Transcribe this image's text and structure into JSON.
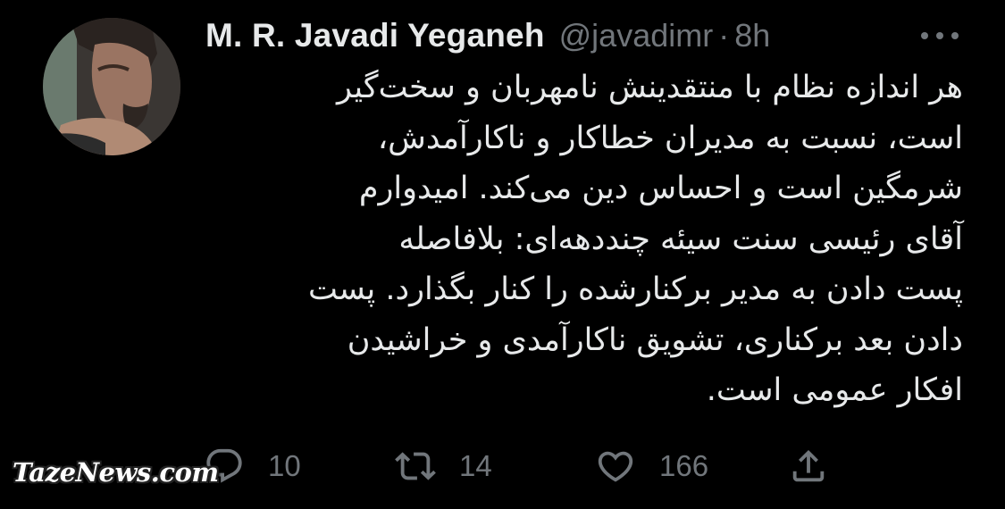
{
  "tweet": {
    "author": {
      "display_name": "M. R. Javadi Yeganeh",
      "handle": "@javadimr",
      "avatar_icon": "profile-photo"
    },
    "separator": "·",
    "time": "8h",
    "more_icon": "more-horizontal-icon",
    "text": "هر اندازه نظام با منتقدینش نامهربان و سخت‌گیر\nاست، نسبت به مدیران خطاکار و ناکارآمدش،\nشرمگین است و احساس دین می‌کند. امیدوارم\nآقای رئیسی سنت سیئه چنددهه‌ای: بلافاصله\nپست دادن به مدیر برکنارشده را کنار بگذارد. پست\nدادن بعد برکناری، تشویق ناکارآمدی و خراشیدن\nافکار عمومی است.",
    "actions": {
      "reply": {
        "icon": "reply-icon",
        "count": "10"
      },
      "retweet": {
        "icon": "retweet-icon",
        "count": "14"
      },
      "like": {
        "icon": "heart-icon",
        "count": "166"
      },
      "share": {
        "icon": "share-icon"
      }
    }
  },
  "watermark": "TazeNews.com",
  "colors": {
    "background": "#000000",
    "primary_text": "#e7e9ea",
    "secondary_text": "#71767b"
  }
}
